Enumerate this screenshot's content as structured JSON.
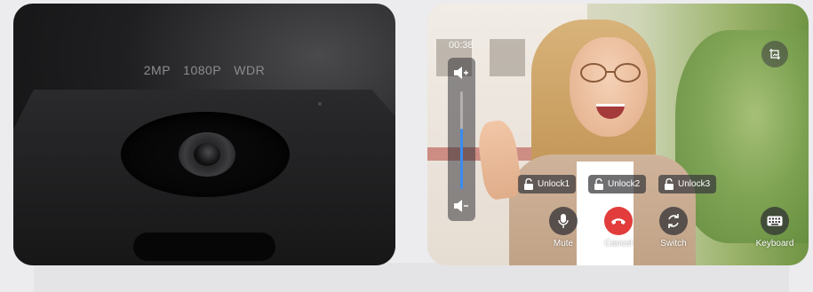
{
  "camera": {
    "specs": "2MP  1080P  WDR"
  },
  "call": {
    "timer": "00:38",
    "volume_level": 0.62,
    "unlock_buttons": [
      "Unlock1",
      "Unlock2",
      "Unlock3"
    ],
    "actions": {
      "mute": "Mute",
      "cancel": "Cancel",
      "switch": "Switch",
      "keyboard": "Keyboard"
    },
    "colors": {
      "cancel": "#e23c3c",
      "volume_fill": "#3a8cf0"
    },
    "icons": {
      "volume_up": "volume-up-icon",
      "volume_down": "volume-down-icon",
      "screenshot": "screenshot-icon",
      "lock": "unlock-icon",
      "mic": "microphone-icon",
      "hangup": "hangup-icon",
      "switch": "switch-camera-icon",
      "keyboard": "keyboard-icon"
    }
  }
}
